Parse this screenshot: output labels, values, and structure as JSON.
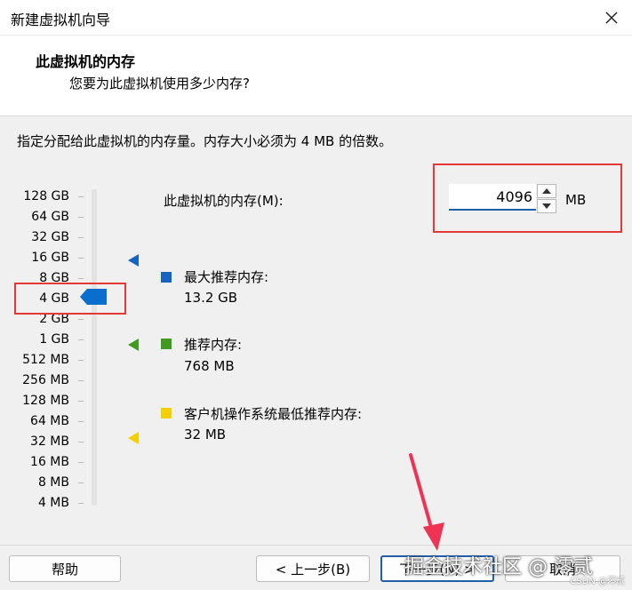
{
  "window": {
    "title": "新建虚拟机向导"
  },
  "header": {
    "title": "此虚拟机的内存",
    "subtitle": "您要为此虚拟机使用多少内存?"
  },
  "instruction": "指定分配给此虚拟机的内存量。内存大小必须为 4 MB 的倍数。",
  "memory_scale": [
    "128 GB",
    "64 GB",
    "32 GB",
    "16 GB",
    "8 GB",
    "4 GB",
    "2 GB",
    "1 GB",
    "512 MB",
    "256 MB",
    "128 MB",
    "64 MB",
    "32 MB",
    "16 MB",
    "8 MB",
    "4 MB"
  ],
  "memory": {
    "label": "此虚拟机的内存(M):",
    "value": "4096",
    "unit": "MB"
  },
  "legend": {
    "max": {
      "title": "最大推荐内存:",
      "value": "13.2 GB",
      "color": "#1565c0"
    },
    "recommended": {
      "title": "推荐内存:",
      "value": "768 MB",
      "color": "#3f9a1f"
    },
    "minimum": {
      "title": "客户机操作系统最低推荐内存:",
      "value": "32 MB",
      "color": "#f5d000"
    }
  },
  "buttons": {
    "help": "帮助",
    "back": "< 上一步(B)",
    "next": "下一步(N) >",
    "cancel": "取消"
  },
  "watermark": {
    "text": "掘金技术社区 @ 澪贰",
    "small": "CSDN @澪贰"
  },
  "colors": {
    "annotation_red": "#e53935",
    "thumb_blue": "#0a6ecf",
    "accent_blue": "#1e5fa8"
  }
}
